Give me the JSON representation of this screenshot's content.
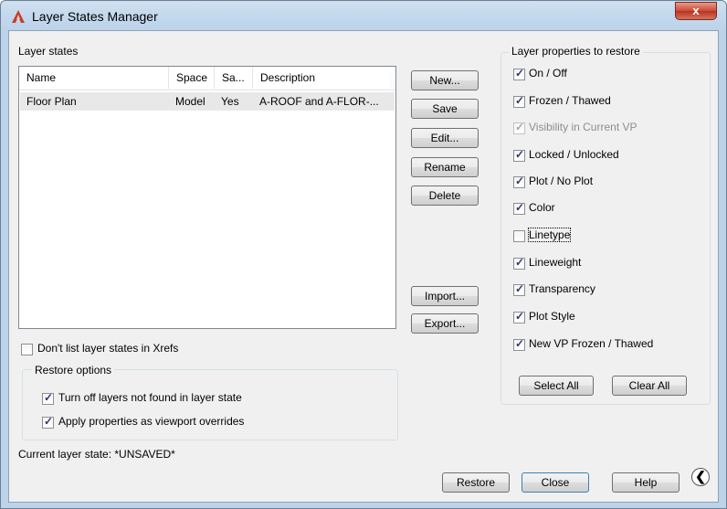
{
  "window": {
    "title": "Layer States Manager",
    "close_glyph": "x",
    "app_icon": "autocad-logo-icon",
    "accent_color": "#c83b2d"
  },
  "layer_states": {
    "group_label": "Layer states",
    "columns": [
      "Name",
      "Space",
      "Sa...",
      "Description"
    ],
    "rows": [
      {
        "name": "Floor Plan",
        "space": "Model",
        "saved": "Yes",
        "description": "A-ROOF and A-FLOR-..."
      }
    ]
  },
  "buttons": {
    "new": "New...",
    "save": "Save",
    "edit": "Edit...",
    "rename": "Rename",
    "delete": "Delete",
    "import": "Import...",
    "export": "Export..."
  },
  "xrefs_checkbox": {
    "label": "Don't list layer states in Xrefs",
    "checked": false
  },
  "restore_options": {
    "title": "Restore options",
    "turn_off": {
      "label": "Turn off layers not found in layer state",
      "checked": true
    },
    "apply_props": {
      "label": "Apply properties as viewport overrides",
      "checked": true
    }
  },
  "current_state": "Current layer state: *UNSAVED*",
  "properties": {
    "title": "Layer properties to restore",
    "items": [
      {
        "label": "On / Off",
        "checked": true
      },
      {
        "label": "Frozen / Thawed",
        "checked": true
      },
      {
        "label": "Visibility in Current VP",
        "checked": true,
        "disabled": true
      },
      {
        "label": "Locked / Unlocked",
        "checked": true
      },
      {
        "label": "Plot / No Plot",
        "checked": true
      },
      {
        "label": "Color",
        "checked": true
      },
      {
        "label": "Linetype",
        "checked": false
      },
      {
        "label": "Lineweight",
        "checked": true
      },
      {
        "label": "Transparency",
        "checked": true
      },
      {
        "label": "Plot Style",
        "checked": true
      },
      {
        "label": "New VP Frozen / Thawed",
        "checked": true
      }
    ],
    "select_all": "Select All",
    "clear_all": "Clear All"
  },
  "footer": {
    "restore": "Restore",
    "close": "Close",
    "help": "Help",
    "collapse_glyph": "❮",
    "collapse_icon": "collapse-arrow-icon"
  }
}
